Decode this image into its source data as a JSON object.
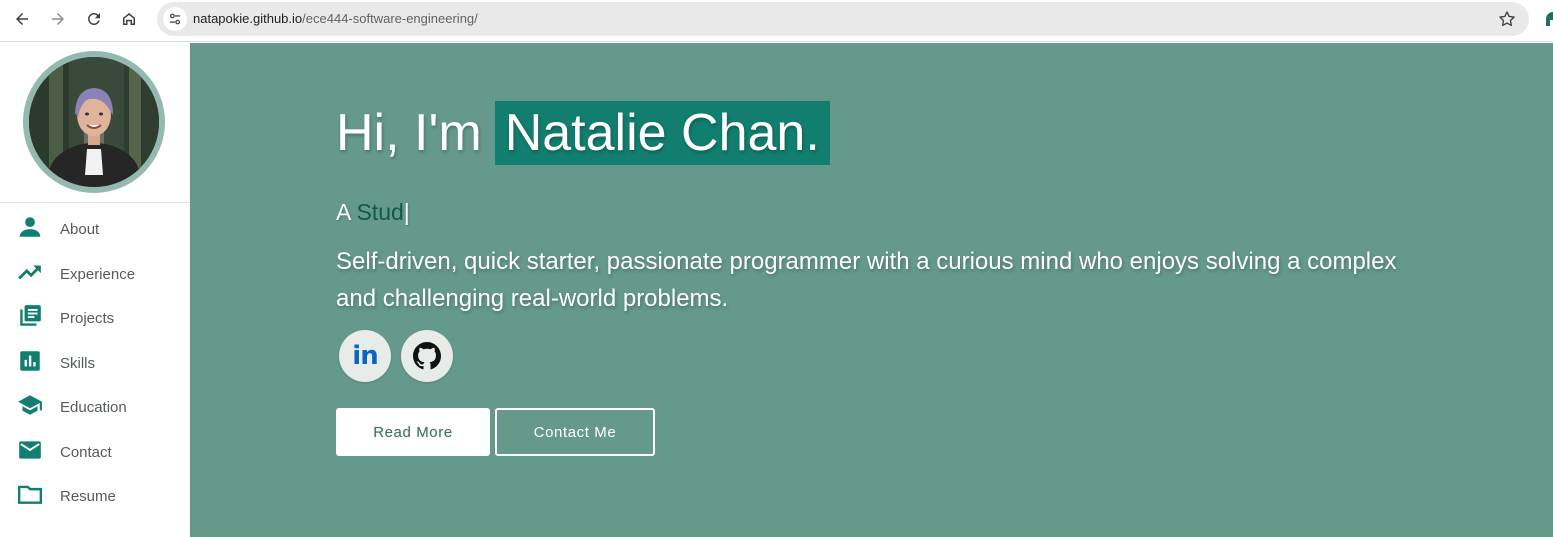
{
  "browser": {
    "url_host": "natapokie.github.io",
    "url_path": "/ece444-software-engineering/",
    "icons": [
      "back-arrow-icon",
      "forward-arrow-icon",
      "reload-icon",
      "home-icon",
      "site-info-icon",
      "bookmark-star-icon"
    ]
  },
  "sidebar": {
    "items": [
      {
        "label": "About",
        "icon": "person-icon"
      },
      {
        "label": "Experience",
        "icon": "trending-up-icon"
      },
      {
        "label": "Projects",
        "icon": "library-books-icon"
      },
      {
        "label": "Skills",
        "icon": "bar-chart-icon"
      },
      {
        "label": "Education",
        "icon": "graduation-cap-icon"
      },
      {
        "label": "Contact",
        "icon": "mail-icon"
      },
      {
        "label": "Resume",
        "icon": "folder-icon"
      }
    ]
  },
  "hero": {
    "greeting": "Hi, I'm",
    "name": "Natalie Chan.",
    "typed_prefix": "A",
    "typed_word": "Stud",
    "typed_cursor": "|",
    "bio": "Self-driven, quick starter, passionate programmer with a curious mind who enjoys solving a complex and challenging real-world problems.",
    "social": {
      "linkedin_text": "in",
      "github_icon": "github-icon"
    },
    "read_more": "Read More",
    "contact_me": "Contact Me"
  },
  "colors": {
    "hero_bg": "#64998b",
    "accent": "#127e6f",
    "sidebar_icon": "#127e6f",
    "avatar_ring": "#93b9b0"
  }
}
